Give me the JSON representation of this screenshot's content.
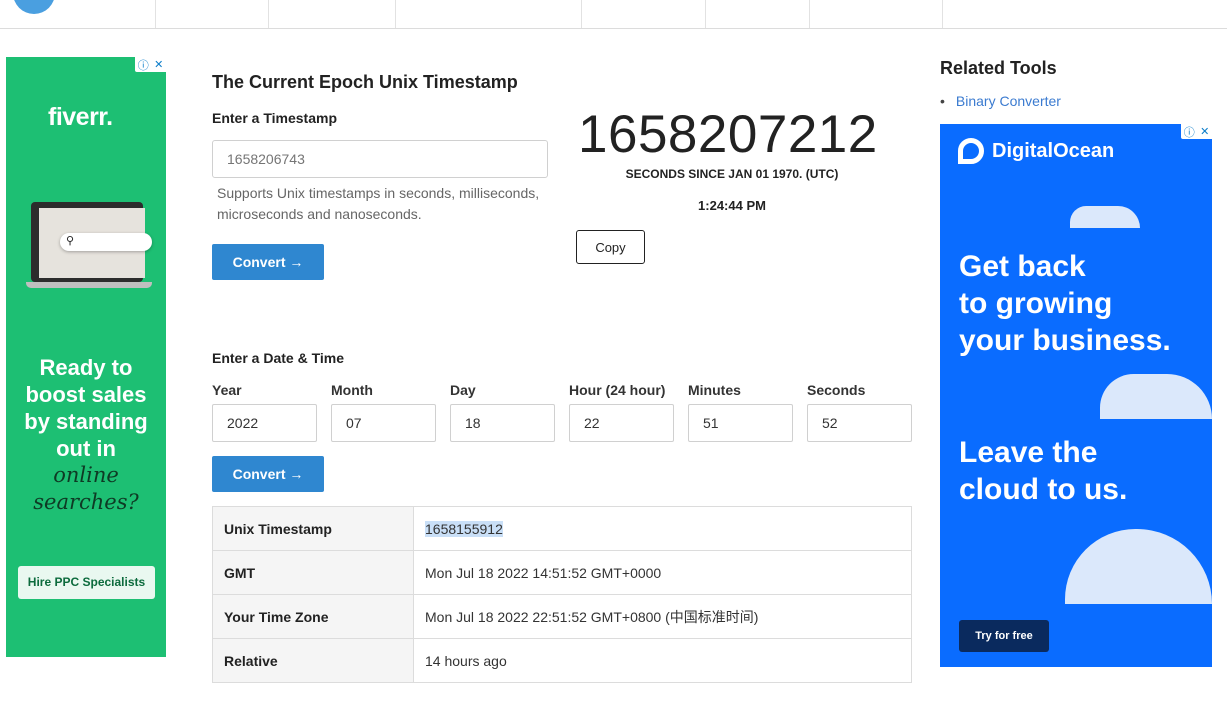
{
  "left_ad": {
    "brand": "fiverr.",
    "search_pill_text": "",
    "headline_lines": [
      "Ready to",
      "boost sales",
      "by standing",
      "out in"
    ],
    "italic_lines": [
      "online",
      "searches?"
    ],
    "cta": "Hire PPC Specialists",
    "adchoices_info": "ⓘ",
    "adchoices_close": "✕"
  },
  "timestamp_tool": {
    "title": "The Current Epoch Unix Timestamp",
    "enter_label": "Enter a Timestamp",
    "input_placeholder": "1658206743",
    "help_text": "Supports Unix timestamps in seconds, milliseconds, microseconds and nanoseconds.",
    "convert_label": "Convert →",
    "current_timestamp": "1658207212",
    "seconds_since": "SECONDS SINCE JAN 01 1970. (UTC)",
    "clock": "1:24:44 PM",
    "copy_label": "Copy"
  },
  "date_tool": {
    "heading": "Enter a Date & Time",
    "fields": [
      {
        "label": "Year",
        "value": "2022"
      },
      {
        "label": "Month",
        "value": "07"
      },
      {
        "label": "Day",
        "value": "18"
      },
      {
        "label": "Hour (24 hour)",
        "value": "22"
      },
      {
        "label": "Minutes",
        "value": "51"
      },
      {
        "label": "Seconds",
        "value": "52"
      }
    ],
    "convert_label": "Convert →"
  },
  "results": [
    {
      "key": "Unix Timestamp",
      "value": "1658155912"
    },
    {
      "key": "GMT",
      "value": "Mon Jul 18 2022 14:51:52 GMT+0000"
    },
    {
      "key": "Your Time Zone",
      "value": "Mon Jul 18 2022 22:51:52 GMT+0800 (中国标准时间)"
    },
    {
      "key": "Relative",
      "value": "14 hours ago"
    }
  ],
  "sidebar": {
    "heading": "Related Tools",
    "links": [
      "Binary Converter"
    ]
  },
  "right_ad": {
    "brand": "DigitalOcean",
    "headline1_lines": [
      "Get back",
      "to growing",
      "your business."
    ],
    "headline2_lines": [
      "Leave the",
      "cloud to us."
    ],
    "cta": "Try for free",
    "adchoices_info": "ⓘ",
    "adchoices_close": "✕"
  },
  "colors": {
    "fiverr_green": "#1dbf73",
    "button_blue": "#2f87d0",
    "do_blue": "#0a6cff",
    "link_blue": "#3b7bd0"
  }
}
